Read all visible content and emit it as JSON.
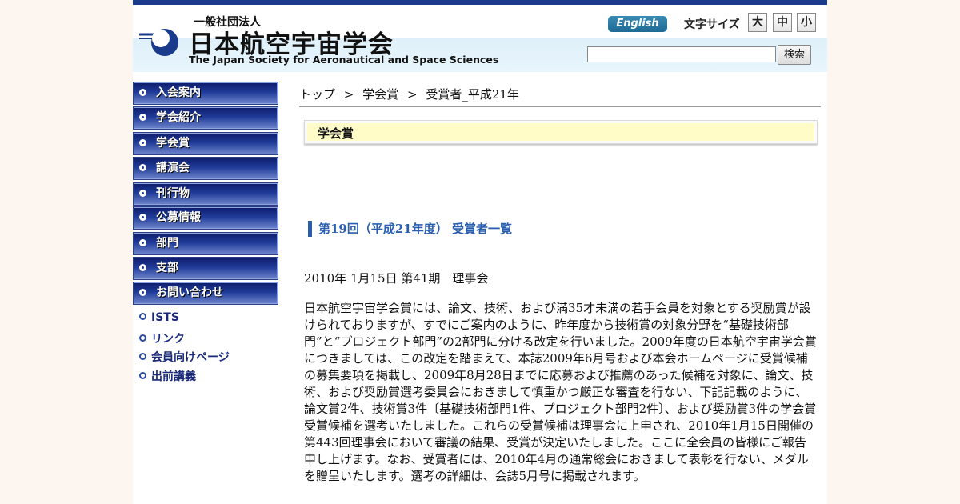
{
  "header": {
    "org_type": "一般社団法人",
    "org_name": "日本航空宇宙学会",
    "org_name_en": "The Japan Society for Aeronautical and Space Sciences",
    "logo_icon": "jsass-logo-icon",
    "english_label": "English",
    "font_size_label": "文字サイズ",
    "font_sizes": [
      "大",
      "中",
      "小"
    ],
    "search_value": "",
    "search_button": "検索"
  },
  "sidebar": {
    "items": [
      {
        "label": "入会案内"
      },
      {
        "label": "学会紹介"
      },
      {
        "label": "学会賞"
      },
      {
        "label": "講演会"
      },
      {
        "label": "刊行物"
      },
      {
        "label": "公募情報"
      },
      {
        "label": "部門"
      },
      {
        "label": "支部"
      },
      {
        "label": "お問い合わせ"
      }
    ],
    "links": [
      {
        "label": "ISTS"
      },
      {
        "label": "リンク"
      },
      {
        "label": "会員向けページ"
      },
      {
        "label": "出前講義"
      }
    ]
  },
  "breadcrumb": {
    "items": [
      "トップ",
      "学会賞",
      "受賞者_平成21年"
    ],
    "separator": ">"
  },
  "main": {
    "section_title": "学会賞",
    "subheading": "第19回（平成21年度） 受賞者一覧",
    "date_line": "2010年 1月15日 第41期　理事会",
    "body": "日本航空宇宙学会賞には、論文、技術、および満35才未満の若手会員を対象とする奨励賞が設けられておりますが、すでにご案内のように、昨年度から技術賞の対象分野を“基礎技術部門”と“プロジェクト部門”の2部門に分ける改定を行いました。2009年度の日本航空宇宙学会賞につきましては、この改定を踏まえて、本誌2009年6月号および本会ホームページに受賞候補の募集要項を掲載し、2009年8月28日までに応募および推薦のあった候補を対象に、論文、技術、および奨励賞選考委員会におきまして慎重かつ厳正な審査を行ない、下記記載のように、論文賞2件、技術賞3件〔基礎技術部門1件、プロジェクト部門2件〕、および奨励賞3件の学会賞受賞候補を選考いたしました。これらの受賞候補は理事会に上申され、2010年1月15日開催の第443回理事会において審議の結果、受賞が決定いたしました。ここに全会員の皆様にご報告申し上げます。なお、受賞者には、2010年4月の通常総会におきまして表彰を行ない、メダルを贈呈いたします。選考の詳細は、会誌5月号に掲載されます。"
  },
  "colors": {
    "top_bar": "#1a3a8c",
    "nav_button": "#1f3b98",
    "subheading_accent": "#2a5fb0",
    "section_box_bg": "#fffcc8"
  }
}
